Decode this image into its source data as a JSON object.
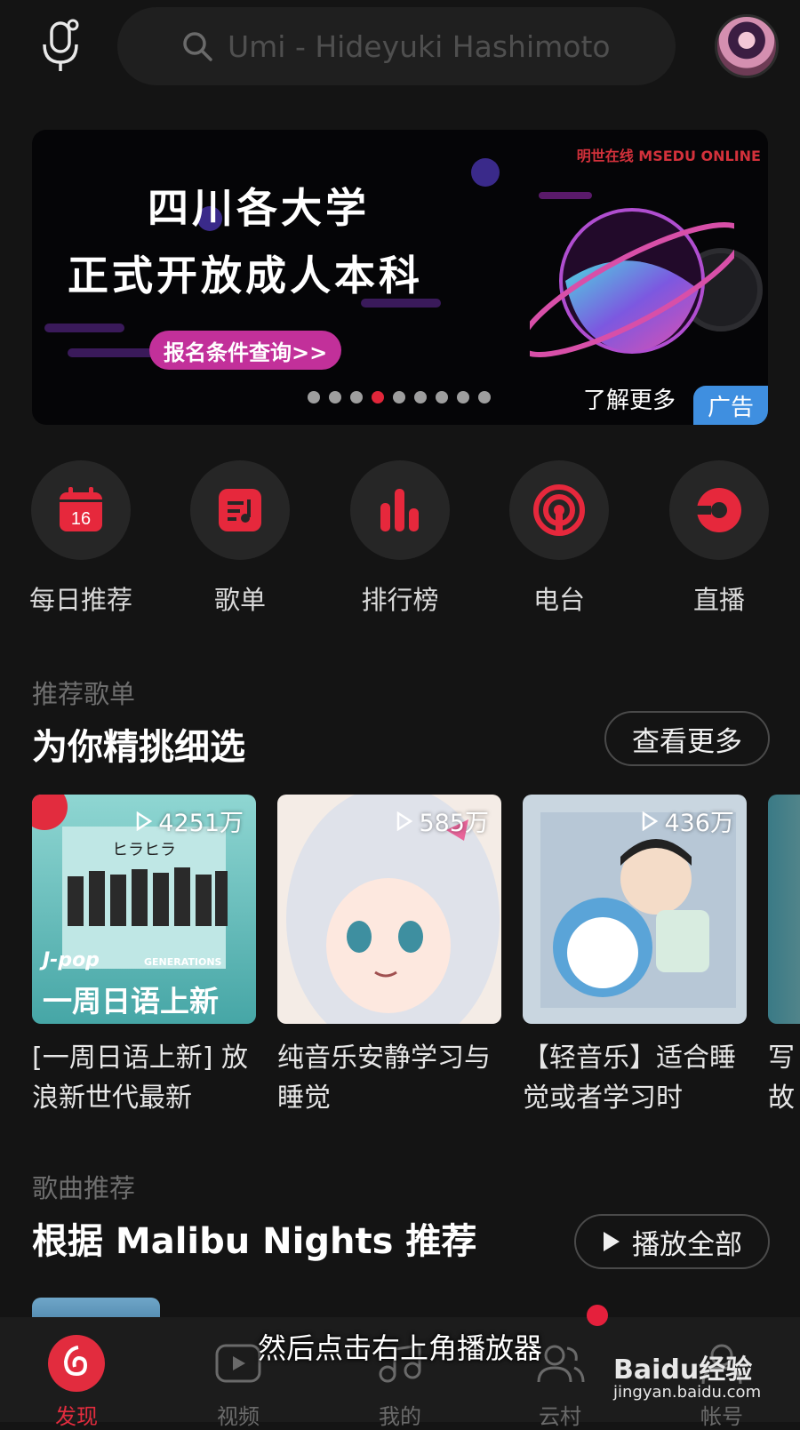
{
  "search": {
    "placeholder": "Umi - Hideyuki Hashimoto"
  },
  "banner": {
    "line1": "四川各大学",
    "line2": "正式开放成人本科",
    "cta": "报名条件查询>>",
    "brand": "明世在线 MSEDU ONLINE",
    "more": "了解更多",
    "ad_tag": "广告",
    "dots_total": 9,
    "active_dot_index": 3
  },
  "quick": [
    {
      "label": "每日推荐",
      "icon": "calendar-icon",
      "day": "16"
    },
    {
      "label": "歌单",
      "icon": "playlist-icon"
    },
    {
      "label": "排行榜",
      "icon": "chart-icon"
    },
    {
      "label": "电台",
      "icon": "radio-icon"
    },
    {
      "label": "直播",
      "icon": "live-icon"
    }
  ],
  "playlists": {
    "subtitle": "推荐歌单",
    "title": "为你精挑细选",
    "more": "查看更多",
    "items": [
      {
        "count": "4251万",
        "title": "[一周日语上新] 放浪新世代最新",
        "cover_label": "J-pop",
        "cover_title": "一周日语上新",
        "cover_artist": "GENERATIONS",
        "cover_kana": "ヒラヒラ"
      },
      {
        "count": "585万",
        "title": "纯音乐安静学习与睡觉"
      },
      {
        "count": "436万",
        "title": "【轻音乐】适合睡觉或者学习时"
      },
      {
        "count": "",
        "title": "写故"
      }
    ]
  },
  "songs": {
    "subtitle": "歌曲推荐",
    "title": "根据 Malibu Nights 推荐",
    "play_all": "播放全部"
  },
  "tabs": [
    {
      "label": "发现",
      "icon": "netease-logo-icon",
      "active": true
    },
    {
      "label": "视频",
      "icon": "video-icon"
    },
    {
      "label": "我的",
      "icon": "music-note-icon"
    },
    {
      "label": "云村",
      "icon": "community-icon"
    },
    {
      "label": "帐号",
      "icon": "account-icon"
    }
  ],
  "overlay": {
    "caption": "然后点击右上角播放器",
    "watermark": "Baidu经验",
    "watermark_url": "jingyan.baidu.com"
  },
  "colors": {
    "accent": "#e22c3e",
    "background": "#141414",
    "ad_blue": "#3f8fe0",
    "banner_pink": "#c2309a"
  }
}
